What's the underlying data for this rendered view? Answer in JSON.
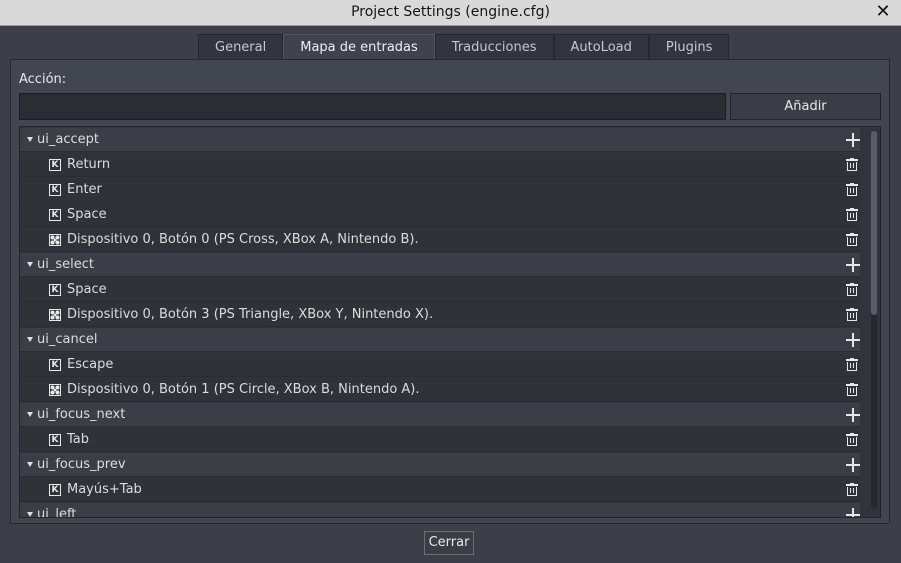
{
  "window": {
    "title": "Project Settings (engine.cfg)",
    "close_glyph": "✕"
  },
  "tabs": [
    {
      "label": "General",
      "active": false
    },
    {
      "label": "Mapa de entradas",
      "active": true
    },
    {
      "label": "Traducciones",
      "active": false
    },
    {
      "label": "AutoLoad",
      "active": false
    },
    {
      "label": "Plugins",
      "active": false
    }
  ],
  "action": {
    "label": "Acción:",
    "value": "",
    "add_label": "Añadir"
  },
  "tree": {
    "rows": [
      {
        "type": "group",
        "text": "ui_accept"
      },
      {
        "type": "item",
        "icon": "keyboard-icon",
        "text": "Return"
      },
      {
        "type": "item",
        "icon": "keyboard-icon",
        "text": "Enter"
      },
      {
        "type": "item",
        "icon": "keyboard-icon",
        "text": "Space"
      },
      {
        "type": "item",
        "icon": "joypad-icon",
        "text": "Dispositivo 0, Botón 0 (PS Cross, XBox A, Nintendo B)."
      },
      {
        "type": "group",
        "text": "ui_select"
      },
      {
        "type": "item",
        "icon": "keyboard-icon",
        "text": "Space"
      },
      {
        "type": "item",
        "icon": "joypad-icon",
        "text": "Dispositivo 0, Botón 3 (PS Triangle, XBox Y, Nintendo X)."
      },
      {
        "type": "group",
        "text": "ui_cancel"
      },
      {
        "type": "item",
        "icon": "keyboard-icon",
        "text": "Escape"
      },
      {
        "type": "item",
        "icon": "joypad-icon",
        "text": "Dispositivo 0, Botón 1 (PS Circle, XBox B, Nintendo A)."
      },
      {
        "type": "group",
        "text": "ui_focus_next"
      },
      {
        "type": "item",
        "icon": "keyboard-icon",
        "text": "Tab"
      },
      {
        "type": "group",
        "text": "ui_focus_prev"
      },
      {
        "type": "item",
        "icon": "keyboard-icon",
        "text": "Mayús+Tab"
      },
      {
        "type": "group",
        "text": "ui_left"
      }
    ],
    "key_glyph": "K"
  },
  "footer": {
    "close_label": "Cerrar"
  }
}
